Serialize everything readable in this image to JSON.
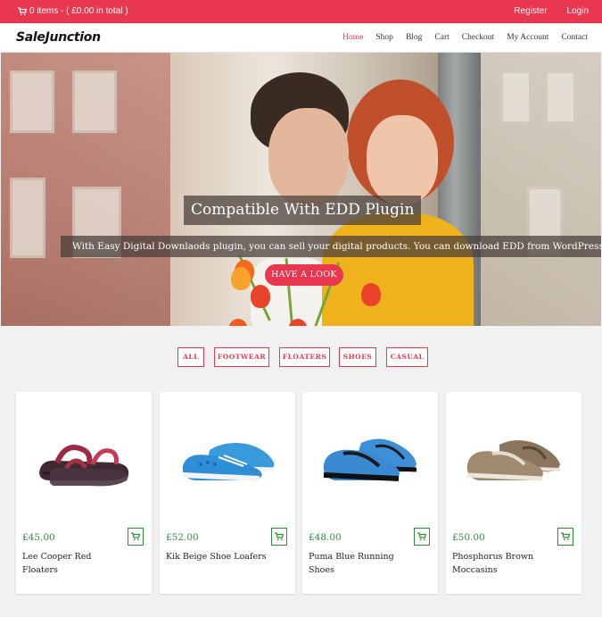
{
  "topbar": {
    "cart_text": "0 items - ( £0.00 in total )",
    "register": "Register",
    "login": "Login",
    "bg_color": "#e8374f"
  },
  "header": {
    "logo": "SaleJunction",
    "nav": [
      "Home",
      "Shop",
      "Blog",
      "Cart",
      "Checkout",
      "My Account",
      "Contact"
    ],
    "active_index": 0
  },
  "hero": {
    "title": "Compatible With EDD Plugin",
    "subtitle": "With Easy Digital Downlaods plugin, you can sell your digital products. You can download EDD from WordPress",
    "button": "HAVE A LOOK"
  },
  "filters": [
    "ALL",
    "FOOTWEAR",
    "FLOATERS",
    "SHOES",
    "CASUAL"
  ],
  "products": [
    {
      "price": "£45.00",
      "name": "Lee Cooper Red Floaters",
      "icon": "sandal-icon"
    },
    {
      "price": "£52.00",
      "name": "Kik Beige Shoe Loafers",
      "icon": "loafer-icon"
    },
    {
      "price": "£48.00",
      "name": "Puma Blue Running Shoes",
      "icon": "running-shoe-icon"
    },
    {
      "price": "£50.00",
      "name": "Phosphorus Brown Moccasins",
      "icon": "moccasin-icon"
    }
  ],
  "colors": {
    "accent": "#e8374f",
    "price": "#2e8b3c"
  }
}
